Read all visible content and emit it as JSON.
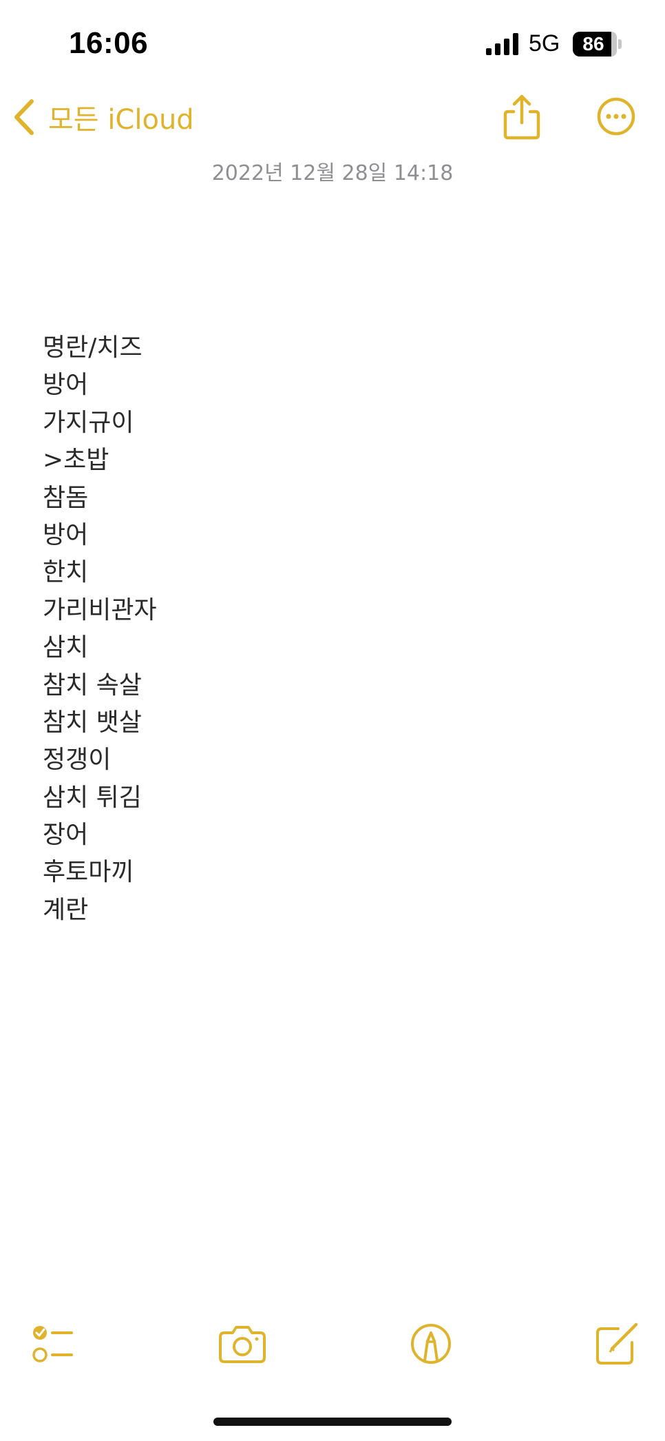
{
  "status_bar": {
    "time": "16:06",
    "network": "5G",
    "battery_level": "86",
    "signal_icon": "cellular-signal-icon",
    "battery_icon": "battery-icon"
  },
  "nav": {
    "back_label": "모든 iCloud",
    "back_icon": "chevron-left-icon",
    "share_icon": "share-icon",
    "more_icon": "ellipsis-circle-icon"
  },
  "note": {
    "timestamp": "2022년 12월 28일 14:18",
    "lines": [
      "명란/치즈",
      "방어",
      "가지규이",
      ">초밥",
      "참돔",
      "방어",
      "한치",
      "가리비관자",
      "삼치",
      "참치 속살",
      "참치 뱃살",
      "정갱이",
      "삼치 튀김",
      "장어",
      "후토마끼",
      "계란"
    ]
  },
  "toolbar": {
    "checklist_icon": "checklist-icon",
    "camera_icon": "camera-icon",
    "markup_icon": "markup-pen-icon",
    "compose_icon": "compose-icon"
  },
  "colors": {
    "accent": "#e0b32c",
    "timestamp": "#8e8e93",
    "text": "#2a2a2a",
    "background": "#ffffff"
  }
}
